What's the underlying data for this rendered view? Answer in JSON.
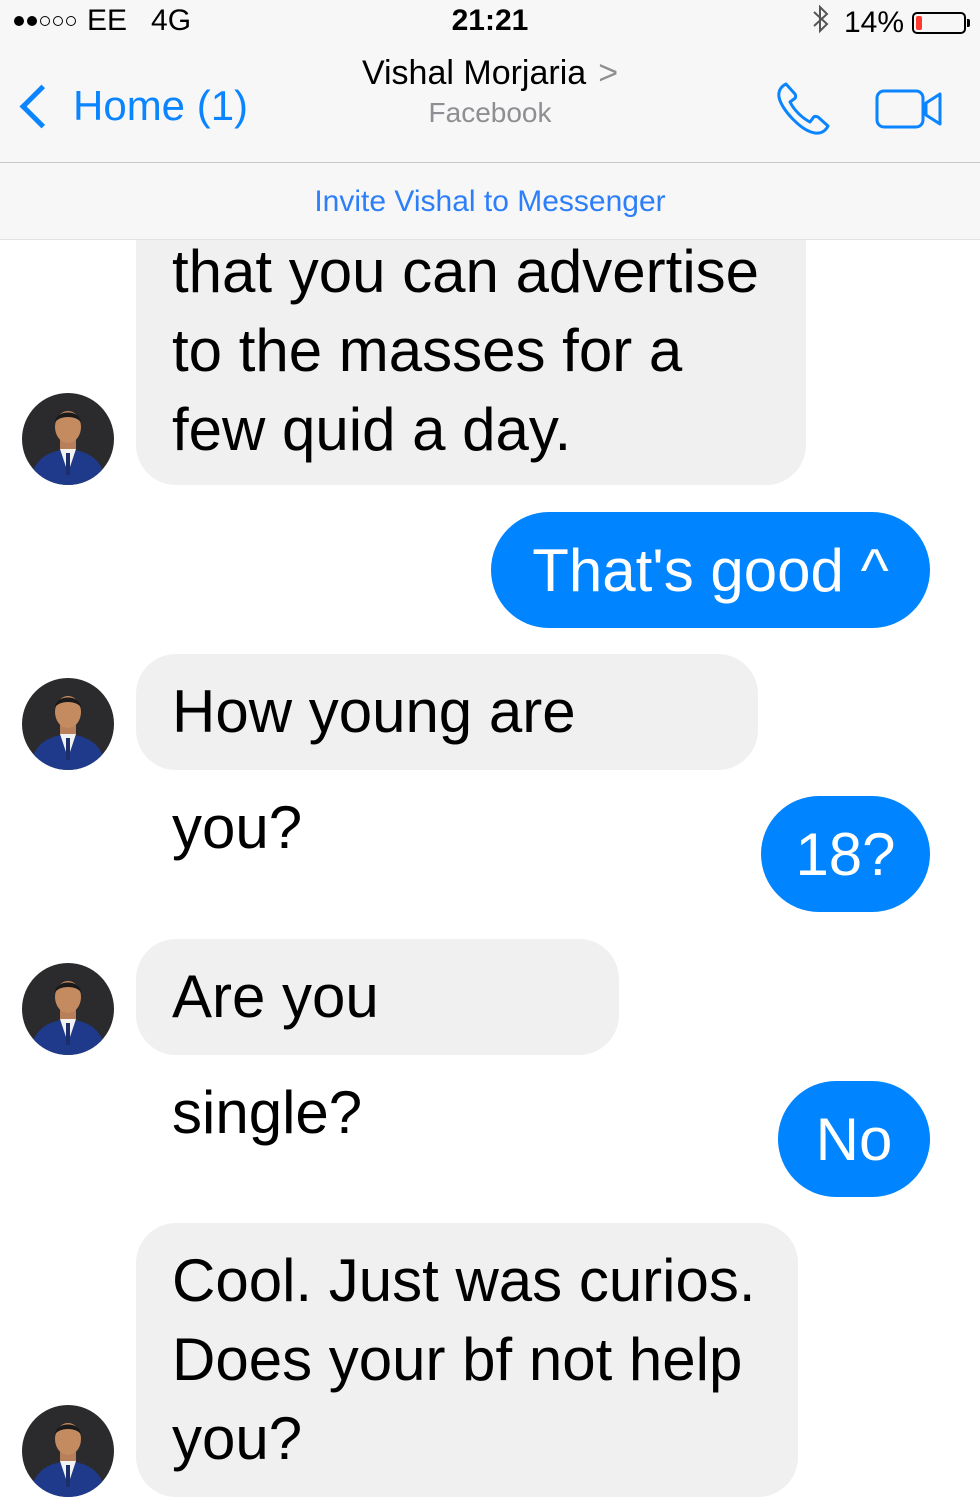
{
  "status_bar": {
    "carrier": "EE",
    "network": "4G",
    "time": "21:21",
    "battery": "14%",
    "battery_level_fraction": 0.14
  },
  "header": {
    "back_label": "Home (1)",
    "contact_name": "Vishal Morjaria",
    "contact_chevron": ">",
    "contact_source": "Facebook",
    "accent_color": "#0a84ff"
  },
  "invite_banner": {
    "text": "Invite Vishal to Messenger"
  },
  "messages": [
    {
      "direction": "incoming",
      "lines": [
        "that you can advertise",
        "to the masses for a",
        "few quid a day."
      ]
    },
    {
      "direction": "outgoing",
      "text": "That's good ^"
    },
    {
      "direction": "incoming",
      "text": "How young are you?"
    },
    {
      "direction": "outgoing",
      "text": "18?"
    },
    {
      "direction": "incoming",
      "text": "Are you single?"
    },
    {
      "direction": "outgoing",
      "text": "No"
    },
    {
      "direction": "incoming",
      "lines": [
        "Cool. Just was curios.",
        "Does your bf not help",
        "you?"
      ]
    }
  ],
  "colors": {
    "outgoing_bubble": "#0084ff",
    "incoming_bubble": "#f1f0f0",
    "link": "#2d7ff9"
  },
  "icons": [
    "phone-icon",
    "video-camera-icon",
    "bluetooth-icon",
    "back-chevron-icon",
    "avatar"
  ]
}
